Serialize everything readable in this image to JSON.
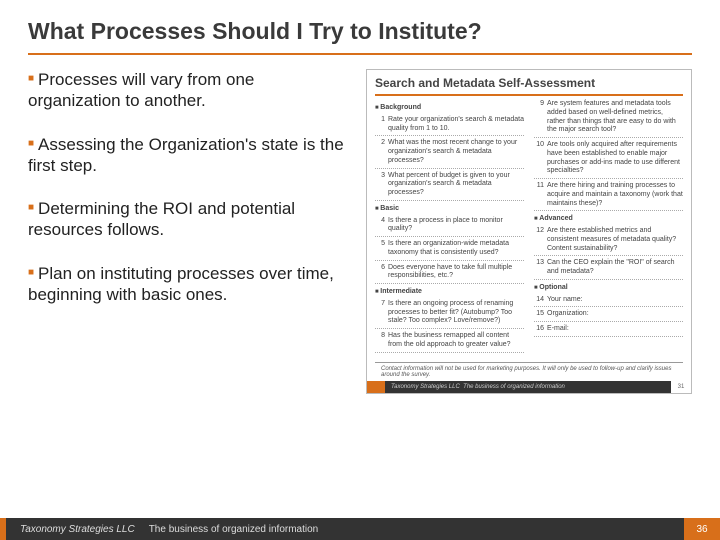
{
  "title": "What Processes Should I Try to Institute?",
  "bullets": [
    "Processes will vary from one organization to another.",
    "Assessing the Organization's state is the first step.",
    "Determining the ROI and potential resources follows.",
    "Plan on instituting processes over time, beginning with basic ones."
  ],
  "embedded": {
    "title": "Search and Metadata Self-Assessment",
    "left": {
      "sec1": "Background",
      "items1": [
        {
          "n": "1",
          "t": "Rate your organization's search & metadata quality from 1 to 10."
        },
        {
          "n": "2",
          "t": "What was the most recent change to your organization's search & metadata processes?"
        },
        {
          "n": "3",
          "t": "What percent of budget is given to your organization's search & metadata processes?"
        }
      ],
      "sec2": "Basic",
      "items2": [
        {
          "n": "4",
          "t": "Is there a process in place to monitor quality?"
        },
        {
          "n": "5",
          "t": "Is there an organization-wide metadata taxonomy that is consistently used?"
        },
        {
          "n": "6",
          "t": "Does everyone have to take full multiple responsibilities, etc.?"
        }
      ],
      "sec3": "Intermediate",
      "items3": [
        {
          "n": "7",
          "t": "Is there an ongoing process of renaming processes to better fit? (Autobump? Too stale? Too complex? Love/remove?)"
        },
        {
          "n": "8",
          "t": "Has the business remapped all content from the old approach to greater value?"
        }
      ]
    },
    "right": {
      "items1": [
        {
          "n": "9",
          "t": "Are system features and metadata tools added based on well-defined metrics, rather than things that are easy to do with the major search tool?"
        },
        {
          "n": "10",
          "t": "Are tools only acquired after requirements have been established to enable major purchases or add-ins made to use different specialties?"
        },
        {
          "n": "11",
          "t": "Are there hiring and training processes to acquire and maintain a taxonomy (work that maintains these)?"
        }
      ],
      "sec2": "Advanced",
      "items2": [
        {
          "n": "12",
          "t": "Are there established metrics and consistent measures of metadata quality? Content sustainability?"
        }
      ],
      "sec3": "Optional",
      "items3": [
        {
          "n": "13",
          "t": "Can the CEO explain the \"ROI\" of search and metadata?"
        },
        {
          "n": "14",
          "t": "Your name:"
        },
        {
          "n": "15",
          "t": "Organization:"
        },
        {
          "n": "16",
          "t": "E-mail:"
        }
      ]
    },
    "footnote": "Contact information will not be used for marketing purposes. It will only be used to follow-up and clarify issues around the survey.",
    "co": "Taxonomy Strategies LLC",
    "tag": "The business of organized information",
    "page": "31"
  },
  "footer": {
    "co": "Taxonomy Strategies LLC",
    "tag": "The business of organized information",
    "page": "36"
  }
}
